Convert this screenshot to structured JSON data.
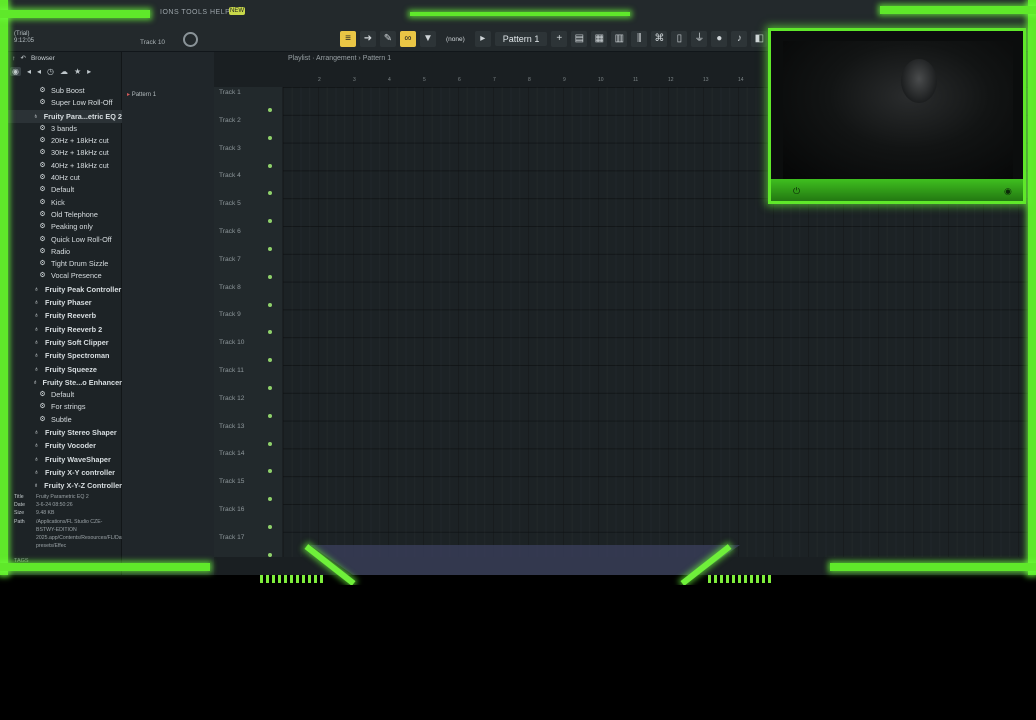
{
  "menu": {
    "text": "IONS TOOLS HELP",
    "hint_badge": "NEW"
  },
  "trial": {
    "label": "(Trial)",
    "time": "9:12:05"
  },
  "track_indicator": "Track 10",
  "toolbar": {
    "none_label": "(none)",
    "pattern_label": "Pattern 1"
  },
  "browser": {
    "title": "Browser",
    "items": [
      {
        "type": "preset",
        "label": "Sub Boost"
      },
      {
        "type": "preset",
        "label": "Super Low Roll-Off"
      },
      {
        "type": "plugin",
        "label": "Fruity Para...etric EQ 2",
        "selected": true
      },
      {
        "type": "preset",
        "label": "3 bands"
      },
      {
        "type": "preset",
        "label": "20Hz + 18kHz cut"
      },
      {
        "type": "preset",
        "label": "30Hz + 18kHz cut"
      },
      {
        "type": "preset",
        "label": "40Hz + 18kHz cut"
      },
      {
        "type": "preset",
        "label": "40Hz cut"
      },
      {
        "type": "preset",
        "label": "Default"
      },
      {
        "type": "preset",
        "label": "Kick"
      },
      {
        "type": "preset",
        "label": "Old Telephone"
      },
      {
        "type": "preset",
        "label": "Peaking only"
      },
      {
        "type": "preset",
        "label": "Quick Low Roll-Off"
      },
      {
        "type": "preset",
        "label": "Radio"
      },
      {
        "type": "preset",
        "label": "Tight Drum Sizzle"
      },
      {
        "type": "preset",
        "label": "Vocal Presence"
      },
      {
        "type": "plugin",
        "label": "Fruity Peak Controller"
      },
      {
        "type": "plugin",
        "label": "Fruity Phaser"
      },
      {
        "type": "plugin",
        "label": "Fruity Reeverb"
      },
      {
        "type": "plugin",
        "label": "Fruity Reeverb 2"
      },
      {
        "type": "plugin",
        "label": "Fruity Soft Clipper"
      },
      {
        "type": "plugin",
        "label": "Fruity Spectroman"
      },
      {
        "type": "plugin",
        "label": "Fruity Squeeze"
      },
      {
        "type": "plugin",
        "label": "Fruity Ste...o Enhancer"
      },
      {
        "type": "preset",
        "label": "Default"
      },
      {
        "type": "preset",
        "label": "For strings"
      },
      {
        "type": "preset",
        "label": "Subtle"
      },
      {
        "type": "plugin",
        "label": "Fruity Stereo Shaper"
      },
      {
        "type": "plugin",
        "label": "Fruity Vocoder"
      },
      {
        "type": "plugin",
        "label": "Fruity WaveShaper"
      },
      {
        "type": "plugin",
        "label": "Fruity X-Y controller"
      },
      {
        "type": "plugin",
        "label": "Fruity X-Y-Z Controller"
      }
    ],
    "file_info": {
      "title_key": "Title",
      "title_val": "Fruity Parametric EQ 2",
      "date_key": "Date",
      "date_val": "3-6-24 08:50:26",
      "size_key": "Size",
      "size_val": "9.48 KB",
      "path_key": "Path",
      "path_val": "/Applications/FL Studio CZE-BSTWY-EDITION 2025.app/Contents/Resources/FL/Data/Patches/Plugin presets/Effec"
    },
    "tags_label": "TAGS"
  },
  "channel": {
    "pattern_item": "Pattern 1"
  },
  "playlist": {
    "title": "Playlist · Arrangement › Pattern 1",
    "ruler": [
      "2",
      "3",
      "4",
      "5",
      "6",
      "7",
      "8",
      "9",
      "10",
      "11",
      "12",
      "13",
      "14"
    ],
    "tracks": [
      "Track 1",
      "Track 2",
      "Track 3",
      "Track 4",
      "Track 5",
      "Track 6",
      "Track 7",
      "Track 8",
      "Track 9",
      "Track 10",
      "Track 11",
      "Track 12",
      "Track 13",
      "Track 14",
      "Track 15",
      "Track 16",
      "Track 17"
    ]
  },
  "colors": {
    "overlay_green": "#5fe82a",
    "accent_yellow": "#e9c545"
  }
}
